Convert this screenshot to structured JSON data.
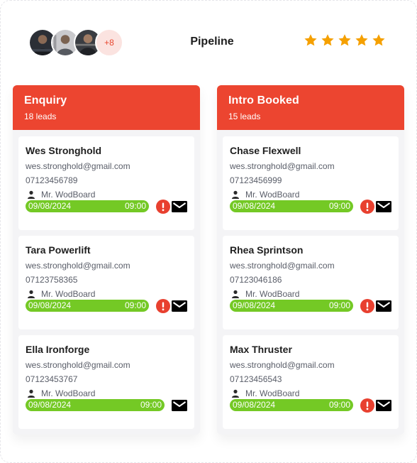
{
  "header": {
    "title": "Pipeline",
    "avatars": [
      "avatar-1",
      "avatar-2",
      "avatar-3"
    ],
    "more_count": "+8",
    "rating": 5,
    "star_color": "#f5a000"
  },
  "colors": {
    "accent": "#ec4530",
    "date_pill": "#74c925",
    "alert": "#e8402f"
  },
  "columns": [
    {
      "title": "Enquiry",
      "count": "18 leads",
      "cards": [
        {
          "name": "Wes Stronghold",
          "email": "wes.stronghold@gmail.com",
          "phone": "07123456789",
          "owner": "Mr. WodBoard",
          "date": "09/08/2024",
          "time": "09:00",
          "alert": true
        },
        {
          "name": "Tara Powerlift",
          "email": "wes.stronghold@gmail.com",
          "phone": "07123758365",
          "owner": "Mr. WodBoard",
          "date": "09/08/2024",
          "time": "09:00",
          "alert": true
        },
        {
          "name": "Ella Ironforge",
          "email": "wes.stronghold@gmail.com",
          "phone": "07123453767",
          "owner": "Mr. WodBoard",
          "date": "09/08/2024",
          "time": "09:00",
          "alert": false
        }
      ]
    },
    {
      "title": "Intro Booked",
      "count": "15 leads",
      "cards": [
        {
          "name": "Chase Flexwell",
          "email": "wes.stronghold@gmail.com",
          "phone": "07123456999",
          "owner": "Mr. WodBoard",
          "date": "09/08/2024",
          "time": "09:00",
          "alert": true
        },
        {
          "name": "Rhea Sprintson",
          "email": "wes.stronghold@gmail.com",
          "phone": "07123046186",
          "owner": "Mr. WodBoard",
          "date": "09/08/2024",
          "time": "09:00",
          "alert": true
        },
        {
          "name": "Max Thruster",
          "email": "wes.stronghold@gmail.com",
          "phone": "07123456543",
          "owner": "Mr. WodBoard",
          "date": "09/08/2024",
          "time": "09:00",
          "alert": true
        }
      ]
    }
  ]
}
